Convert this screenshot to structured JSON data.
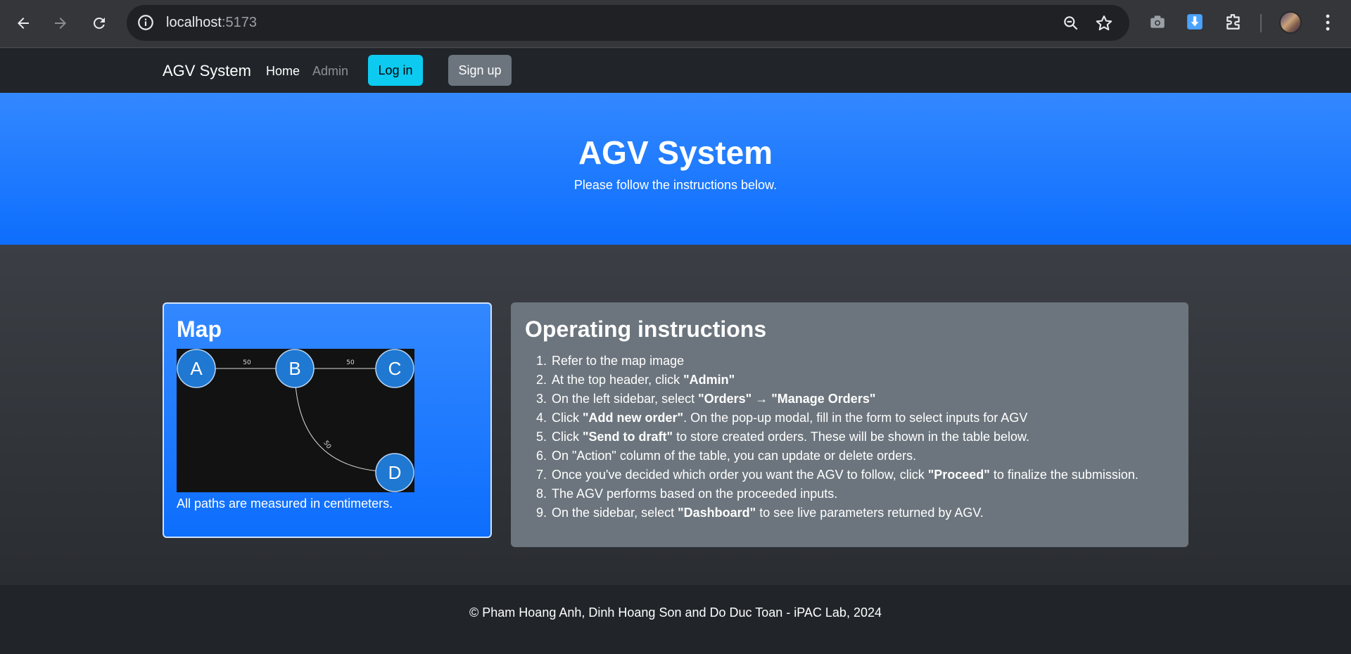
{
  "browser": {
    "url_host": "localhost",
    "url_port": ":5173",
    "icons": [
      "back-arrow-icon",
      "forward-arrow-icon",
      "reload-icon",
      "site-info-icon",
      "zoom-out-icon",
      "bookmark-star-icon",
      "camera-icon",
      "download-icon",
      "extensions-icon",
      "profile-avatar",
      "menu-kebab-icon"
    ]
  },
  "navbar": {
    "brand": "AGV System",
    "links": [
      "Home",
      "Admin"
    ],
    "login_label": "Log in",
    "signup_label": "Sign up"
  },
  "hero": {
    "title": "AGV System",
    "subtitle": "Please follow the instructions below."
  },
  "map_card": {
    "title": "Map",
    "nodes": [
      "A",
      "B",
      "C",
      "D"
    ],
    "edge_labels": [
      "50",
      "50",
      "50"
    ],
    "caption": "All paths are measured in centimeters."
  },
  "instructions": {
    "title": "Operating instructions",
    "steps": [
      {
        "pre": "Refer to the map image",
        "b1": "",
        "mid": "",
        "b2": "",
        "post": ""
      },
      {
        "pre": "At the top header, click ",
        "b1": "\"Admin\"",
        "mid": "",
        "b2": "",
        "post": ""
      },
      {
        "pre": "On the left sidebar, select ",
        "b1": "\"Orders\"",
        "mid": " → ",
        "b2": "\"Manage Orders\"",
        "post": ""
      },
      {
        "pre": "Click ",
        "b1": "\"Add new order\"",
        "mid": ". On the pop-up modal, fill in the form to select inputs for AGV",
        "b2": "",
        "post": ""
      },
      {
        "pre": "Click ",
        "b1": "\"Send to draft\"",
        "mid": " to store created orders. These will be shown in the table below.",
        "b2": "",
        "post": ""
      },
      {
        "pre": "On \"Action\" column of the table, you can update or delete orders.",
        "b1": "",
        "mid": "",
        "b2": "",
        "post": ""
      },
      {
        "pre": "Once you've decided which order you want the AGV to follow, click ",
        "b1": "\"Proceed\"",
        "mid": " to finalize the submission.",
        "b2": "",
        "post": ""
      },
      {
        "pre": "The AGV performs based on the proceeded inputs.",
        "b1": "",
        "mid": "",
        "b2": "",
        "post": ""
      },
      {
        "pre": "On the sidebar, select ",
        "b1": "\"Dashboard\"",
        "mid": " to see live parameters returned by AGV.",
        "b2": "",
        "post": ""
      }
    ]
  },
  "footer": {
    "text": "© Pham Hoang Anh, Dinh Hoang Son and Do Duc Toan - iPAC Lab, 2024"
  }
}
